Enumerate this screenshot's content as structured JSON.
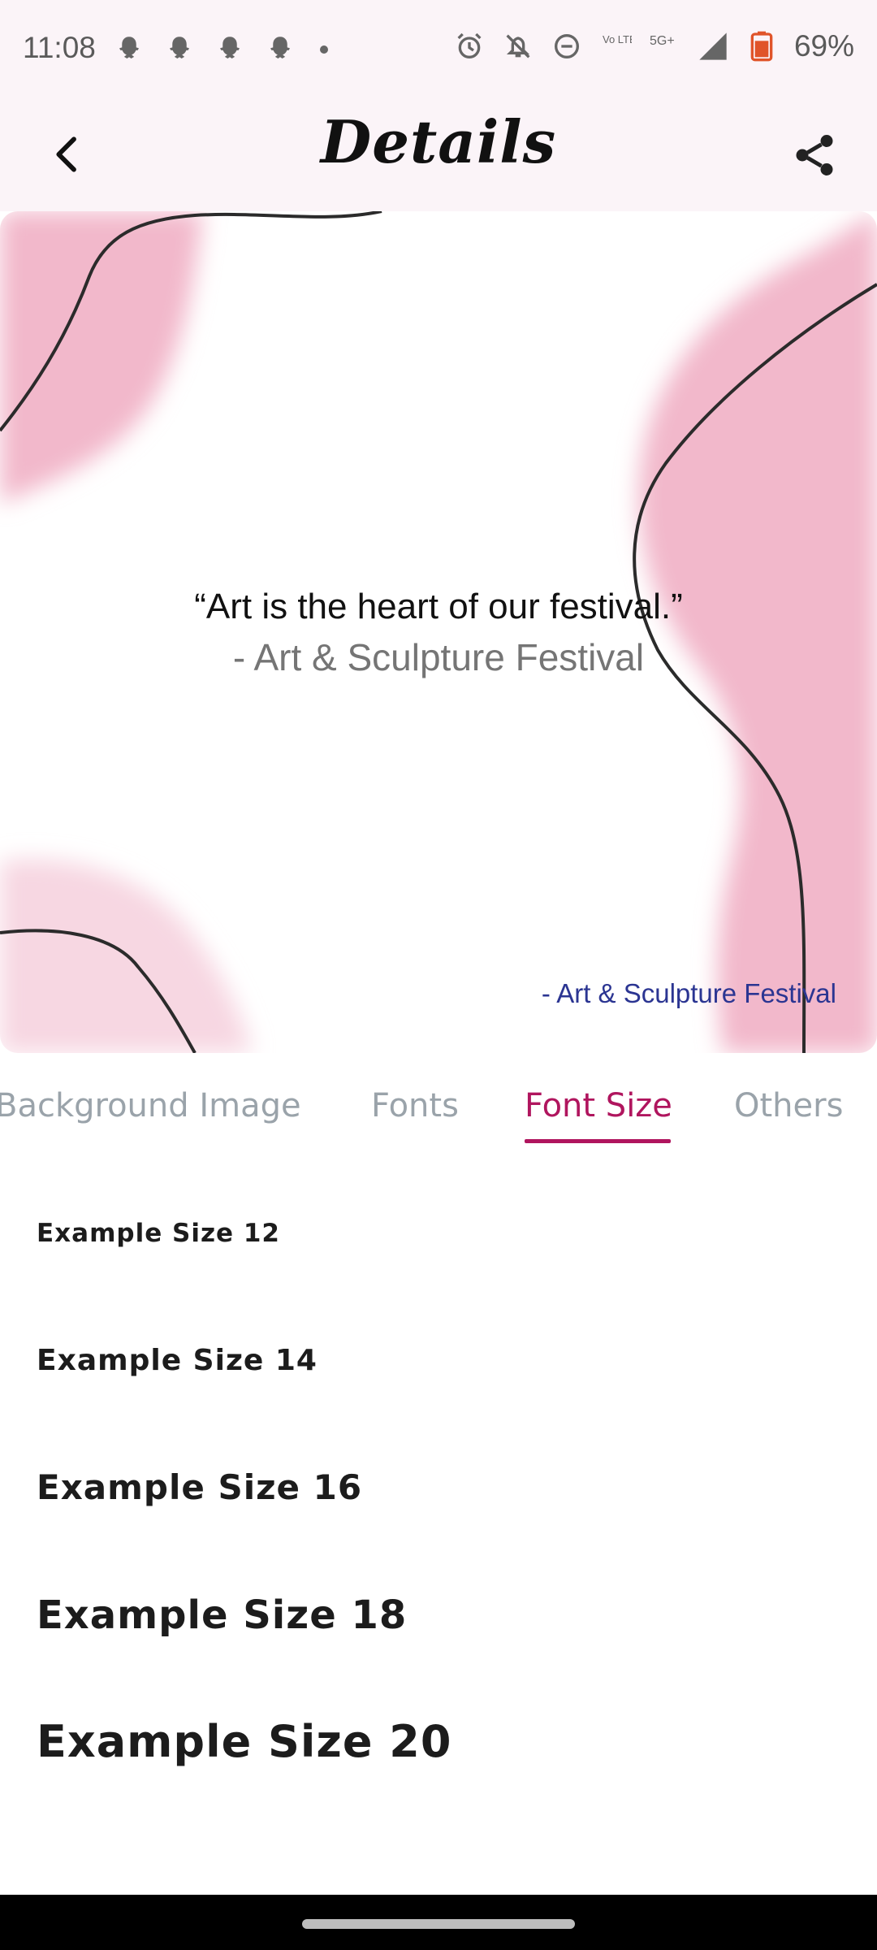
{
  "status_bar": {
    "time": "11:08",
    "battery": "69%",
    "notification_icons": [
      "snapchat-ghost-icon",
      "snapchat-ghost-icon",
      "snapchat-ghost-icon",
      "snapchat-ghost-icon",
      "dot-icon"
    ],
    "system_icons": [
      "alarm-icon",
      "bell-muted-icon",
      "dnd-icon",
      "volte-icon",
      "5g-icon",
      "signal-icon",
      "battery-icon"
    ],
    "network_text_volte": "Vo LTE",
    "network_text_5g": "5G+"
  },
  "header": {
    "title": "Details"
  },
  "preview": {
    "quote": "“Art is the heart of our festival.”",
    "author": "- Art & Sculpture Festival",
    "corner_author": "- Art & Sculpture Festival",
    "colors": {
      "blob": "#f2b8cb",
      "blob_light": "#f7d7e2",
      "line": "#2b2b2b",
      "corner_author": "#2b3592"
    }
  },
  "tabs": [
    {
      "label": "Background Image",
      "active": false
    },
    {
      "label": "Fonts",
      "active": false
    },
    {
      "label": "Font Size",
      "active": true
    },
    {
      "label": "Others",
      "active": false
    }
  ],
  "font_sizes": [
    {
      "label": "Example Size 12"
    },
    {
      "label": "Example Size 14"
    },
    {
      "label": "Example Size 16"
    },
    {
      "label": "Example Size 18"
    },
    {
      "label": "Example Size 20"
    }
  ],
  "colors": {
    "accent": "#b0155e",
    "tab_inactive": "#9aa3aa",
    "header_bg": "#fbf4f8"
  }
}
